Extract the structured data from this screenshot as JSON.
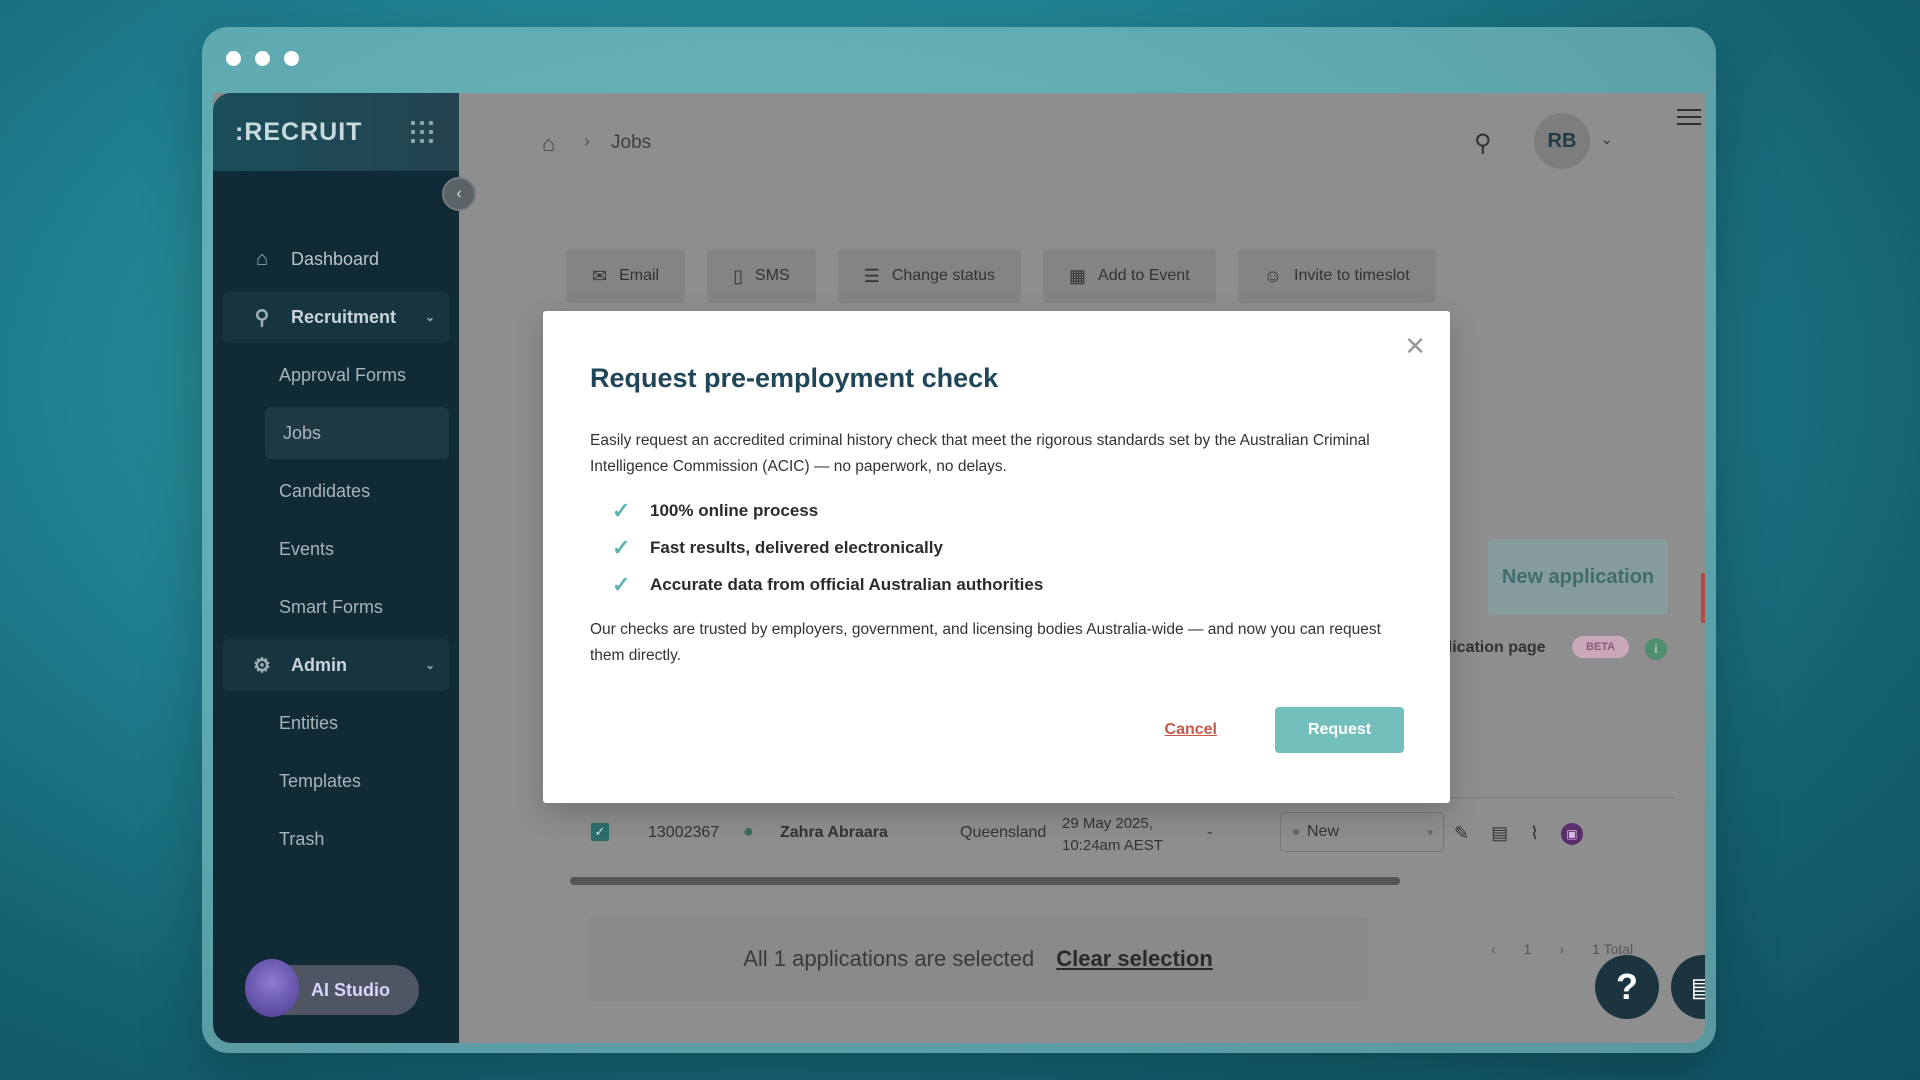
{
  "sidebar": {
    "brand": ":RECRUIT",
    "items": [
      {
        "label": "Dashboard"
      },
      {
        "label": "Recruitment"
      },
      {
        "label": "Approval Forms"
      },
      {
        "label": "Jobs"
      },
      {
        "label": "Candidates"
      },
      {
        "label": "Events"
      },
      {
        "label": "Smart Forms"
      },
      {
        "label": "Admin"
      },
      {
        "label": "Entities"
      },
      {
        "label": "Templates"
      },
      {
        "label": "Trash"
      }
    ],
    "ai_studio": "AI Studio"
  },
  "header": {
    "breadcrumb_current": "Jobs",
    "user_initials": "RB"
  },
  "toolbar": {
    "email": "Email",
    "sms": "SMS",
    "change_status": "Change status",
    "add_to_event": "Add to Event",
    "invite_to_timeslot": "Invite to timeslot"
  },
  "page": {
    "new_application": "New application",
    "application_page": "plication page",
    "beta": "BETA"
  },
  "table": {
    "row": {
      "id": "13002367",
      "name": "Zahra Abraara",
      "state": "Queensland",
      "date_line1": "29 May 2025,",
      "date_line2": "10:24am AEST",
      "dash": "-",
      "status": "New"
    }
  },
  "selection": {
    "text": "All 1 applications are selected",
    "clear": "Clear selection"
  },
  "pager": {
    "page": "1",
    "total": "1 Total"
  },
  "modal": {
    "title": "Request pre-employment check",
    "intro": "Easily request an accredited criminal history check that meet the rigorous standards set by the Australian Criminal Intelligence Commission (ACIC) — no paperwork, no delays.",
    "bullets": [
      "100% online process",
      "Fast results, delivered electronically",
      "Accurate data from official Australian authorities"
    ],
    "outro": "Our checks are trusted by employers, government, and licensing bodies Australia-wide — and now you can request them directly.",
    "cancel": "Cancel",
    "request": "Request"
  },
  "colors": {
    "accent": "#72bfbc",
    "title": "#1f4757",
    "cancel": "#c9574c",
    "sidebar": "#102a36"
  }
}
